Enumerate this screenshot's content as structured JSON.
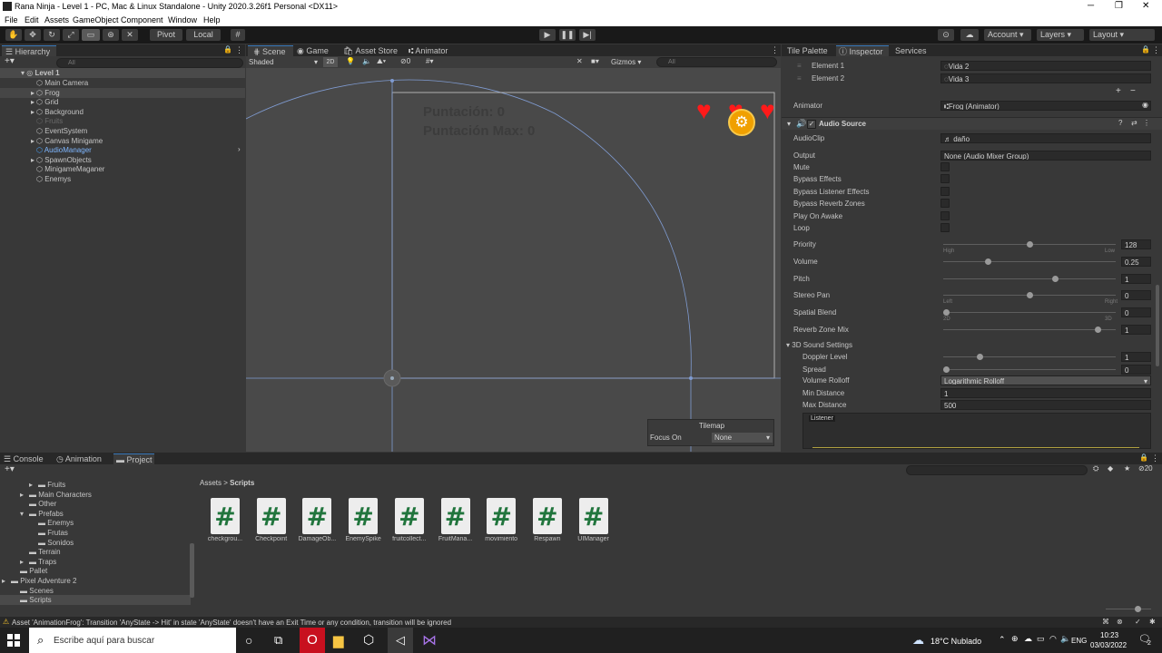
{
  "window": {
    "title": "Rana Ninja - Level 1 - PC, Mac & Linux Standalone - Unity 2020.3.26f1 Personal <DX11>"
  },
  "menu": [
    "File",
    "Edit",
    "Assets",
    "GameObject",
    "Component",
    "Window",
    "Help"
  ],
  "toolbar": {
    "pivot": "Pivot",
    "local": "Local",
    "account": "Account",
    "layers": "Layers",
    "layout": "Layout"
  },
  "hierarchy": {
    "tab": "Hierarchy",
    "search_placeholder": "All",
    "scene": "Level 1",
    "items": [
      {
        "label": "Main Camera",
        "arrow": false,
        "dim": false,
        "selected": false
      },
      {
        "label": "Frog",
        "arrow": true,
        "dim": false,
        "selected": false
      },
      {
        "label": "Grid",
        "arrow": true,
        "dim": false,
        "selected": false
      },
      {
        "label": "Background",
        "arrow": true,
        "dim": false,
        "selected": false
      },
      {
        "label": "Fruits",
        "arrow": false,
        "dim": true,
        "selected": false
      },
      {
        "label": "EventSystem",
        "arrow": false,
        "dim": false,
        "selected": false
      },
      {
        "label": "Canvas Minigame",
        "arrow": true,
        "dim": false,
        "selected": false
      },
      {
        "label": "AudioManager",
        "arrow": false,
        "dim": false,
        "selected": true
      },
      {
        "label": "SpawnObjects",
        "arrow": true,
        "dim": false,
        "selected": false
      },
      {
        "label": "MinigameMaganer",
        "arrow": false,
        "dim": false,
        "selected": false
      },
      {
        "label": "Enemys",
        "arrow": false,
        "dim": false,
        "selected": false
      }
    ]
  },
  "scene_tabs": [
    "Scene",
    "Game",
    "Asset Store",
    "Animator"
  ],
  "scene_toolbar": {
    "shading": "Shaded",
    "mode2d": "2D",
    "hidden_count": "0",
    "gizmos": "Gizmos",
    "search_placeholder": "All"
  },
  "scene_view": {
    "score": "Puntación: 0",
    "max_score": "Puntación Max: 0",
    "tilemap_title": "Tilemap",
    "focus_label": "Focus On",
    "focus_value": "None"
  },
  "inspector": {
    "tabs": [
      "Tile Palette",
      "Inspector",
      "Services"
    ],
    "elements": [
      {
        "label": "Element 1",
        "value": "Vida 2"
      },
      {
        "label": "Element 2",
        "value": "Vida 3"
      }
    ],
    "animator_label": "Animator",
    "animator_value": "Frog (Animator)",
    "component": "Audio Source",
    "audioclip_label": "AudioClip",
    "audioclip_value": "daño",
    "output_label": "Output",
    "output_value": "None (Audio Mixer Group)",
    "toggles": [
      "Mute",
      "Bypass Effects",
      "Bypass Listener Effects",
      "Bypass Reverb Zones",
      "Play On Awake",
      "Loop"
    ],
    "sliders": [
      {
        "label": "Priority",
        "value": "128",
        "fraction": 0.5,
        "left": "High",
        "right": "Low"
      },
      {
        "label": "Volume",
        "value": "0.25",
        "fraction": 0.25,
        "left": "",
        "right": ""
      },
      {
        "label": "Pitch",
        "value": "1",
        "fraction": 0.65,
        "left": "",
        "right": ""
      },
      {
        "label": "Stereo Pan",
        "value": "0",
        "fraction": 0.5,
        "left": "Left",
        "right": "Right"
      },
      {
        "label": "Spatial Blend",
        "value": "0",
        "fraction": 0.0,
        "left": "2D",
        "right": "3D"
      },
      {
        "label": "Reverb Zone Mix",
        "value": "1",
        "fraction": 0.91,
        "left": "",
        "right": ""
      }
    ],
    "sound3d_label": "3D Sound Settings",
    "sound3d": [
      {
        "label": "Doppler Level",
        "value": "1",
        "fraction": 0.2
      },
      {
        "label": "Spread",
        "value": "0",
        "fraction": 0.0
      }
    ],
    "rolloff_label": "Volume Rolloff",
    "rolloff_value": "Logarithmic Rolloff",
    "min_label": "Min Distance",
    "min_value": "1",
    "max_label": "Max Distance",
    "max_value": "500",
    "listener": "Listener"
  },
  "bottom": {
    "tabs": [
      "Console",
      "Animation",
      "Project"
    ],
    "tree": [
      {
        "label": "Fruits",
        "indent": 2,
        "arrow": true
      },
      {
        "label": "Main Characters",
        "indent": 1,
        "arrow": true
      },
      {
        "label": "Other",
        "indent": 1,
        "arrow": false
      },
      {
        "label": "Prefabs",
        "indent": 1,
        "arrow": true,
        "open": true
      },
      {
        "label": "Enemys",
        "indent": 2,
        "arrow": false
      },
      {
        "label": "Frutas",
        "indent": 2,
        "arrow": false
      },
      {
        "label": "Sonidos",
        "indent": 2,
        "arrow": false
      },
      {
        "label": "Terrain",
        "indent": 1,
        "arrow": false
      },
      {
        "label": "Traps",
        "indent": 1,
        "arrow": true
      },
      {
        "label": "Pallet",
        "indent": 0,
        "arrow": false
      },
      {
        "label": "Pixel Adventure 2",
        "indent": -1,
        "arrow": true
      },
      {
        "label": "Scenes",
        "indent": 0,
        "arrow": false
      },
      {
        "label": "Scripts",
        "indent": 0,
        "arrow": false,
        "selected": true
      }
    ],
    "breadcrumb_root": "Assets",
    "breadcrumb_leaf": "Scripts",
    "icon_count": "20",
    "scripts": [
      "checkgrou...",
      "Checkpoint",
      "DamageOb...",
      "EnemySpike",
      "fruitcollect...",
      "FruitMana...",
      "movimiento",
      "Respawn",
      "UIManager"
    ]
  },
  "status_message": "Asset 'AnimationFrog': Transition 'AnyState -> Hit' in state 'AnyState' doesn't have an Exit Time or any condition, transition will be ignored",
  "taskbar": {
    "search_placeholder": "Escribe aquí para buscar",
    "weather": "18°C  Nublado",
    "lang": "ENG",
    "time": "10:23",
    "date": "03/03/2022",
    "notif": "2"
  }
}
